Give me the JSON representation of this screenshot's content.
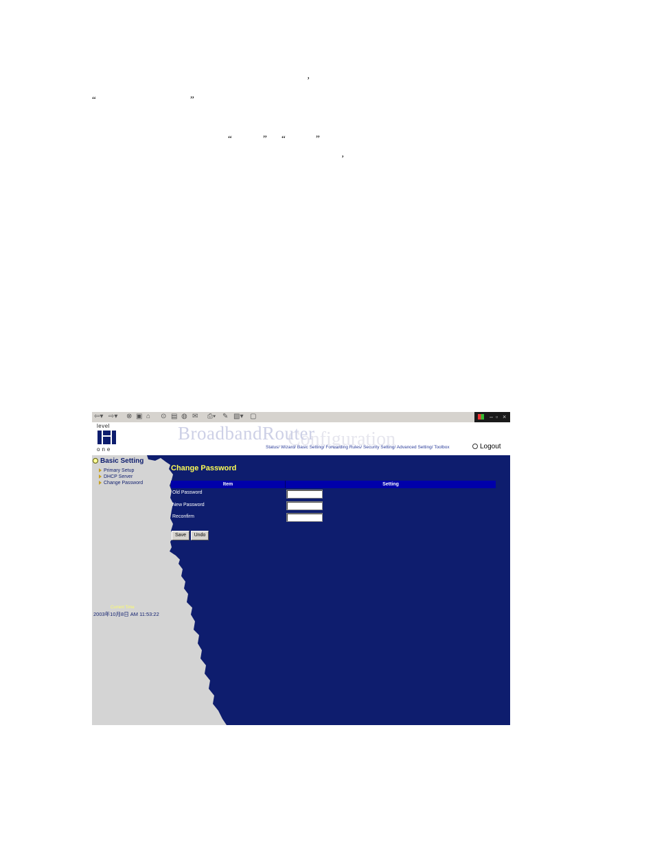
{
  "doc_marks": {
    "comma1": "’",
    "quote_open1": "“",
    "quote_close1": "”",
    "quote_open2": "“",
    "quote_close2": "”",
    "quote_open3": "“",
    "quote_close3": "”",
    "comma2": "’"
  },
  "browser": {
    "toolbar_icons": [
      "back-arrow-icon",
      "forward-arrow-icon",
      "stop-icon",
      "refresh-icon",
      "home-icon",
      "search-icon",
      "favorites-icon",
      "history-icon",
      "mail-icon",
      "print-icon",
      "edit-icon",
      "discuss-icon",
      "messenger-icon"
    ]
  },
  "header": {
    "logo_top": "level",
    "logo_bottom": "one",
    "brand": "BroadbandRouter",
    "brand_sub": "Configuration",
    "nav_links": "Status/ Wizard/ Basic Setting/ Forwarding Rules/ Security Setting/ Advanced Setting/ Toolbox",
    "logout": "Logout"
  },
  "sidebar": {
    "title": "Basic Setting",
    "items": [
      {
        "label": "Primary Setup"
      },
      {
        "label": "DHCP Server"
      },
      {
        "label": "Change Password"
      }
    ],
    "time_label": "Current Time",
    "time_value": "2003年10月8日 AM 11:53:22"
  },
  "main": {
    "title": "Change Password",
    "columns": [
      "Item",
      "Setting"
    ],
    "rows": [
      {
        "label": "Old Password",
        "value": ""
      },
      {
        "label": "New Password",
        "value": ""
      },
      {
        "label": "Reconfirm",
        "value": ""
      }
    ],
    "save_label": "Save",
    "undo_label": "Undo"
  },
  "colors": {
    "content_bg": "#0e1d6e",
    "sidebar_bg": "#d4d4d4",
    "title": "#ffff55",
    "table_header": "#0000aa"
  }
}
